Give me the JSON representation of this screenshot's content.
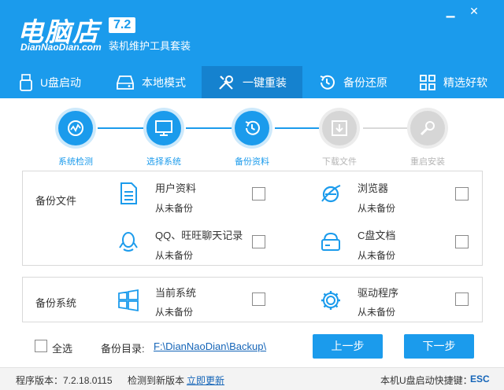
{
  "app": {
    "logo_text": "电脑店",
    "logo_sub": "DianNaoDian.com",
    "version": "7.2",
    "tagline": "装机维护工具套装"
  },
  "window": {
    "minimize": "▁",
    "close": "✕"
  },
  "nav": [
    {
      "label": "U盘启动",
      "icon": "usb-icon",
      "active": false
    },
    {
      "label": "本地模式",
      "icon": "hard-drive-icon",
      "active": false
    },
    {
      "label": "一键重装",
      "icon": "wrench-screwdriver-icon",
      "active": true
    },
    {
      "label": "备份还原",
      "icon": "restore-icon",
      "active": false
    },
    {
      "label": "精选好软",
      "icon": "apps-grid-icon",
      "active": false
    }
  ],
  "steps": [
    {
      "label": "系统检测",
      "state": "done"
    },
    {
      "label": "选择系统",
      "state": "done"
    },
    {
      "label": "备份资料",
      "state": "current"
    },
    {
      "label": "下载文件",
      "state": "pending"
    },
    {
      "label": "重启安装",
      "state": "pending"
    }
  ],
  "backup_files": {
    "section_label": "备份文件",
    "items": [
      {
        "title": "用户资料",
        "status": "从未备份",
        "icon": "document-icon",
        "checked": false
      },
      {
        "title": "浏览器",
        "status": "从未备份",
        "icon": "browser-icon",
        "checked": false
      },
      {
        "title": "QQ、旺旺聊天记录",
        "status": "从未备份",
        "icon": "qq-icon",
        "checked": false
      },
      {
        "title": "C盘文档",
        "status": "从未备份",
        "icon": "drive-c-icon",
        "checked": false
      }
    ]
  },
  "backup_system": {
    "section_label": "备份系统",
    "items": [
      {
        "title": "当前系统",
        "status": "从未备份",
        "icon": "windows-icon",
        "checked": false
      },
      {
        "title": "驱动程序",
        "status": "从未备份",
        "icon": "gear-icon",
        "checked": false
      }
    ]
  },
  "footer_actions": {
    "select_all": "全选",
    "dir_label": "备份目录:",
    "dir_path": "F:\\DianNaoDian\\Backup\\",
    "prev": "上一步",
    "next": "下一步"
  },
  "statusbar": {
    "version_text": "程序版本：7.2.18.0115",
    "update_text": "检测到新版本",
    "update_link": "立即更新",
    "shortcut_text": "本机U盘启动快捷键：",
    "shortcut_key": "ESC"
  },
  "colors": {
    "primary": "#1b9bec",
    "nav_active": "#1582cf",
    "link": "#1565b8"
  }
}
